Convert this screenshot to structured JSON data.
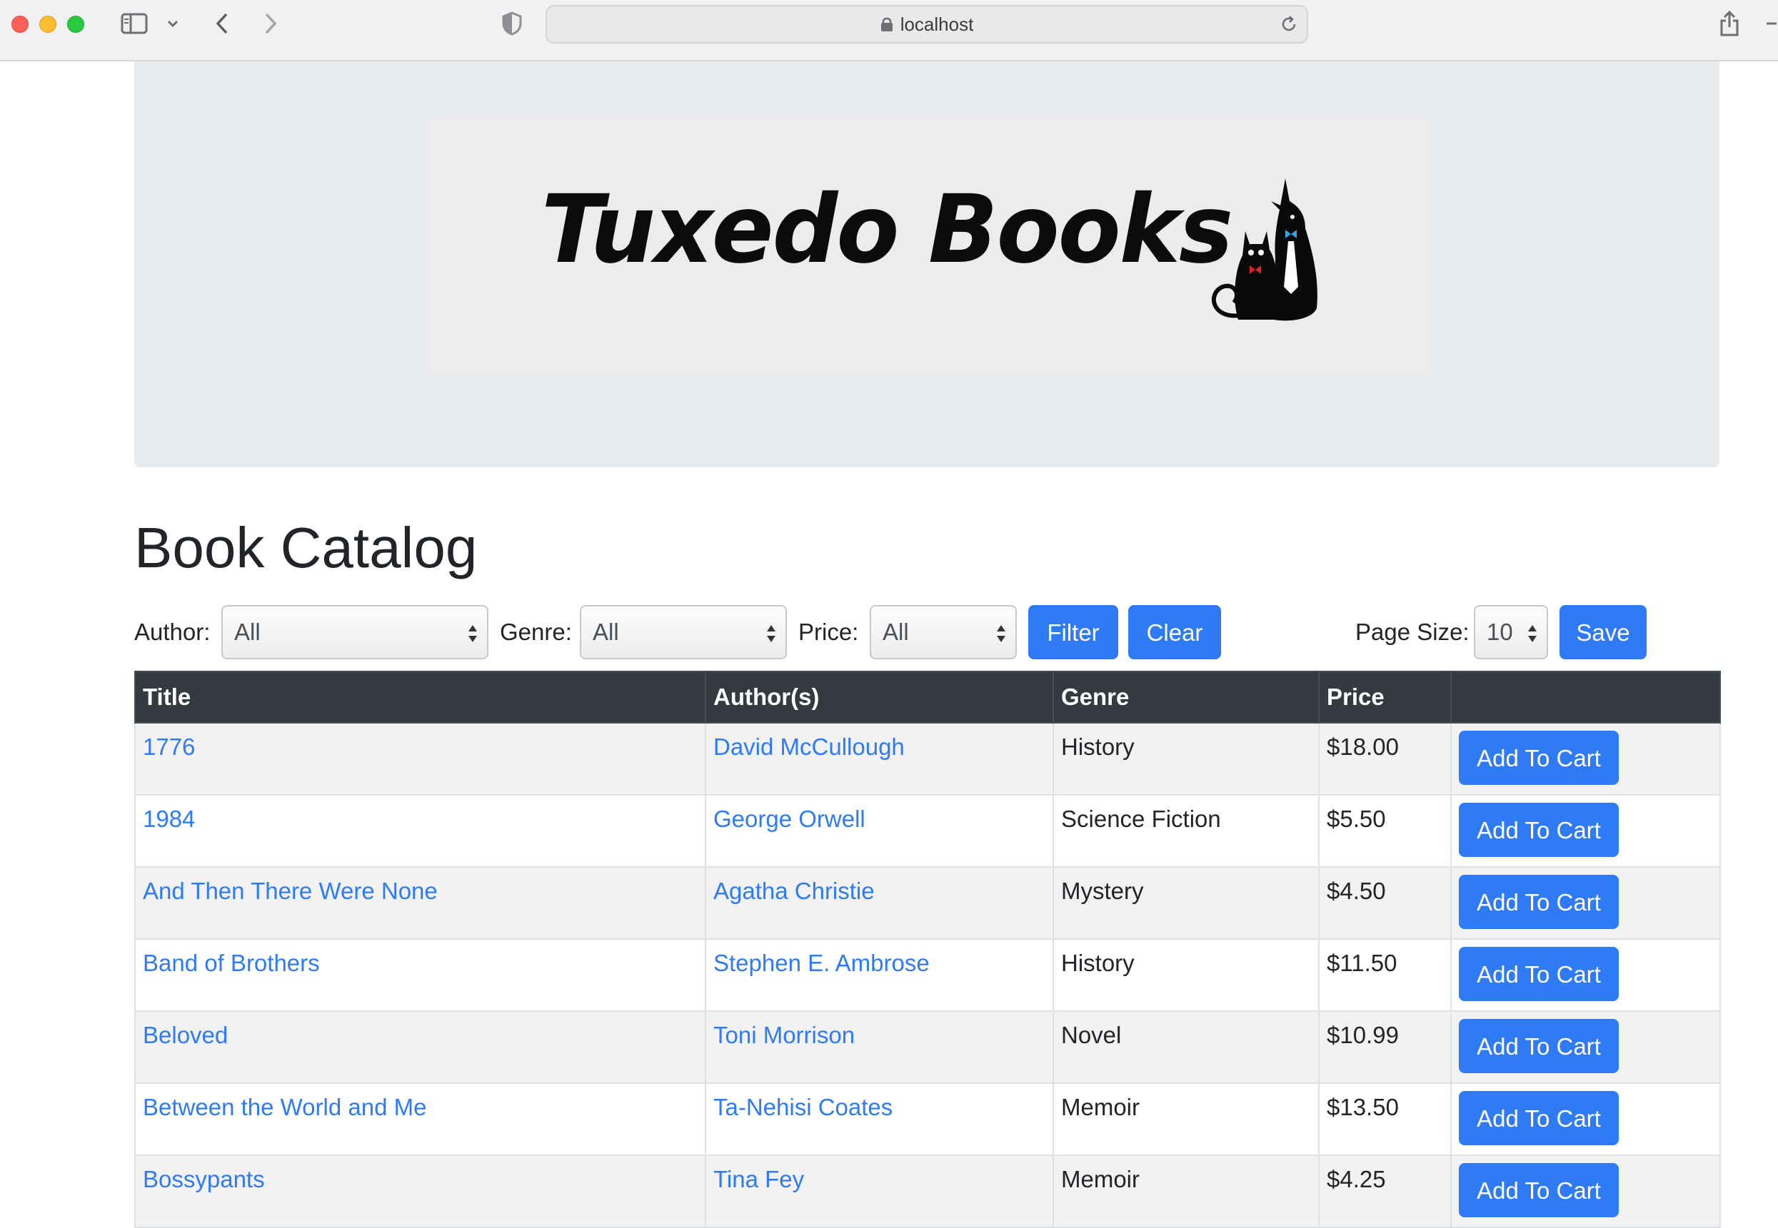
{
  "browser": {
    "url": "localhost"
  },
  "banner": {
    "logo_text": "Tuxedo Books"
  },
  "page": {
    "title": "Book Catalog"
  },
  "filters": {
    "author_label": "Author:",
    "author_value": "All",
    "genre_label": "Genre:",
    "genre_value": "All",
    "price_label": "Price:",
    "price_value": "All",
    "filter_button": "Filter",
    "clear_button": "Clear",
    "page_size_label": "Page Size:",
    "page_size_value": "10",
    "save_button": "Save"
  },
  "table": {
    "headers": [
      "Title",
      "Author(s)",
      "Genre",
      "Price",
      ""
    ],
    "rows": [
      {
        "title": "1776",
        "author": "David McCullough",
        "genre": "History",
        "price": "$18.00",
        "action": "Add To Cart"
      },
      {
        "title": "1984",
        "author": "George Orwell",
        "genre": "Science Fiction",
        "price": "$5.50",
        "action": "Add To Cart"
      },
      {
        "title": "And Then There Were None",
        "author": "Agatha Christie",
        "genre": "Mystery",
        "price": "$4.50",
        "action": "Add To Cart"
      },
      {
        "title": "Band of Brothers",
        "author": "Stephen E. Ambrose",
        "genre": "History",
        "price": "$11.50",
        "action": "Add To Cart"
      },
      {
        "title": "Beloved",
        "author": "Toni Morrison",
        "genre": "Novel",
        "price": "$10.99",
        "action": "Add To Cart"
      },
      {
        "title": "Between the World and Me",
        "author": "Ta-Nehisi Coates",
        "genre": "Memoir",
        "price": "$13.50",
        "action": "Add To Cart"
      },
      {
        "title": "Bossypants",
        "author": "Tina Fey",
        "genre": "Memoir",
        "price": "$4.25",
        "action": "Add To Cart"
      }
    ]
  },
  "colors": {
    "primary": "#2f7bf5",
    "table_header": "#343a40",
    "banner_bg": "#e9ecef"
  }
}
